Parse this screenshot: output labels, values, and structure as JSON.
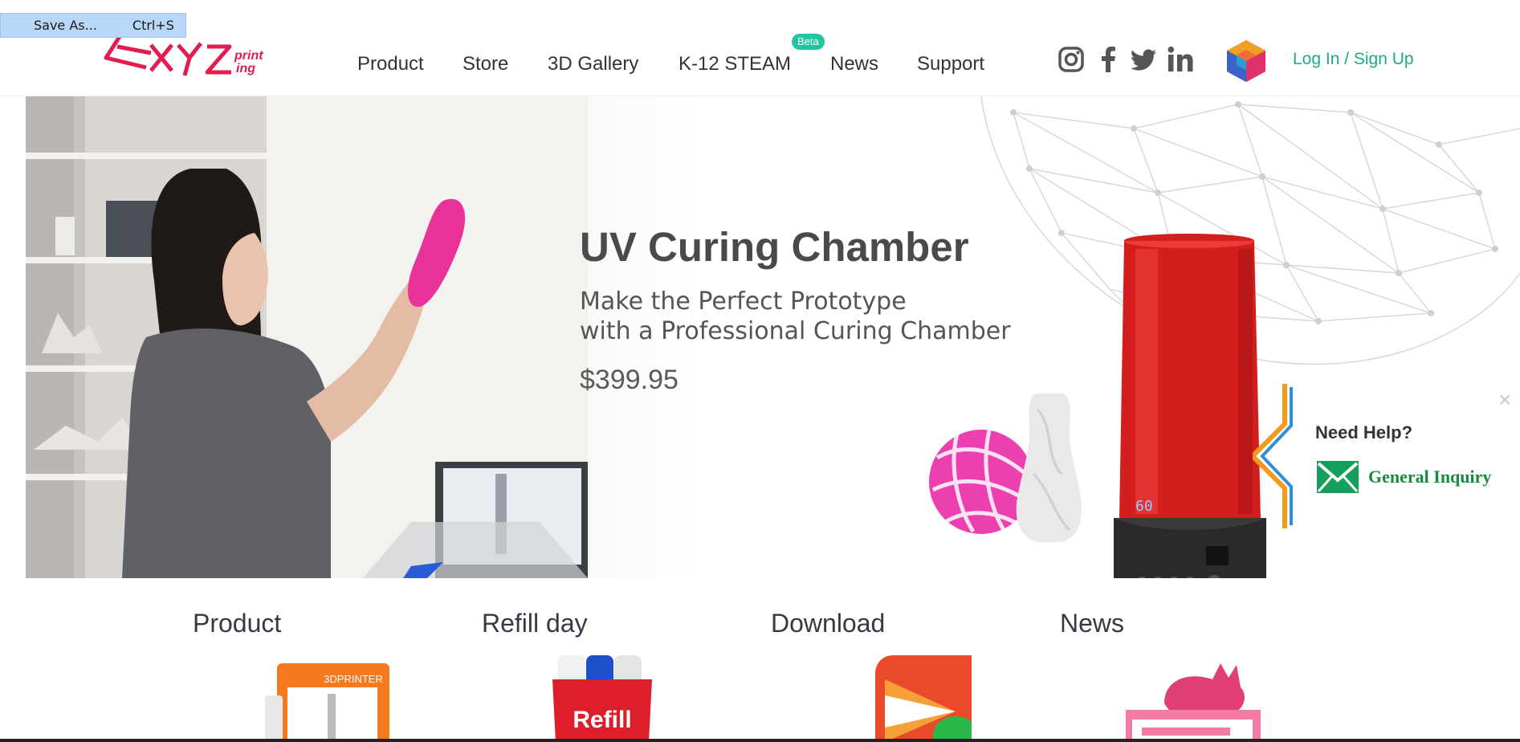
{
  "context_menu": {
    "label": "Save As...",
    "shortcut": "Ctrl+S"
  },
  "header": {
    "nav": [
      {
        "label": "Product"
      },
      {
        "label": "Store"
      },
      {
        "label": "3D Gallery"
      },
      {
        "label": "K-12 STEAM",
        "badge": "Beta"
      },
      {
        "label": "News"
      },
      {
        "label": "Support"
      }
    ],
    "social_icons": [
      "instagram-icon",
      "facebook-icon",
      "twitter-icon",
      "linkedin-icon"
    ],
    "login_label": "Log In / Sign Up"
  },
  "banner": {
    "title": "UV Curing Chamber",
    "subtitle_line1": "Make the Perfect Prototype",
    "subtitle_line2": "with a Professional Curing Chamber",
    "price": "$399.95",
    "device_display": "60"
  },
  "help_widget": {
    "close": "×",
    "title": "Need Help?",
    "link_label": "General Inquiry"
  },
  "sections": [
    {
      "title": "Product",
      "image_text": "3DPRINTER"
    },
    {
      "title": "Refill day",
      "image_text": "Refill"
    },
    {
      "title": "Download"
    },
    {
      "title": "News"
    }
  ],
  "colors": {
    "brand_red": "#e31b4e",
    "accent_green": "#1eaa85",
    "beta_badge": "#1ec7a1",
    "inquiry_green": "#168a3d",
    "context_menu_bg": "#b9d7f7"
  }
}
